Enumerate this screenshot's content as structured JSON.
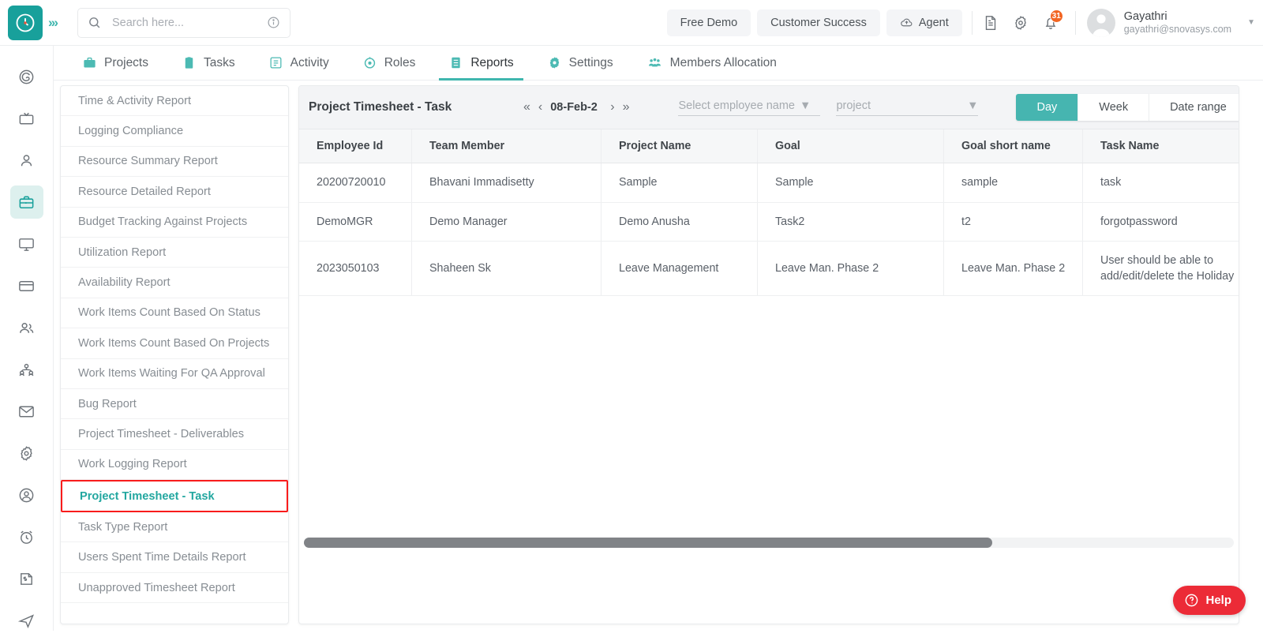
{
  "header": {
    "logo_icon": "clock-logo-icon",
    "expand_icon": "chevron-double-right-icon",
    "search": {
      "placeholder": "Search here...",
      "value": "",
      "icon": "search-icon",
      "info_icon": "info-circle-icon"
    },
    "buttons": [
      {
        "label": "Free Demo",
        "icon": ""
      },
      {
        "label": "Customer Success",
        "icon": ""
      },
      {
        "label": "Agent",
        "icon": "cloud-upload-icon"
      }
    ],
    "icons": [
      {
        "name": "document-icon"
      },
      {
        "name": "gear-icon"
      },
      {
        "name": "bell-icon",
        "badge": "31"
      }
    ],
    "user": {
      "name": "Gayathri",
      "email": "gayathri@snovasys.com",
      "avatar_icon": "avatar-icon",
      "caret_icon": "chevron-down-icon"
    },
    "accent": "#18a09b",
    "badge_color": "#f26522"
  },
  "nav": {
    "tabs": [
      {
        "label": "Projects",
        "icon": "briefcase-icon",
        "active": false
      },
      {
        "label": "Tasks",
        "icon": "clipboard-icon",
        "active": false
      },
      {
        "label": "Activity",
        "icon": "list-icon",
        "active": false
      },
      {
        "label": "Roles",
        "icon": "target-icon",
        "active": false
      },
      {
        "label": "Reports",
        "icon": "report-icon",
        "active": true
      },
      {
        "label": "Settings",
        "icon": "gear-icon",
        "active": false
      },
      {
        "label": "Members Allocation",
        "icon": "people-group-icon",
        "active": false
      }
    ]
  },
  "rail": {
    "items": [
      {
        "icon": "dashboard-spiral-icon",
        "active": false
      },
      {
        "icon": "tv-icon",
        "active": false
      },
      {
        "icon": "user-icon",
        "active": false
      },
      {
        "icon": "briefcase-icon",
        "active": true
      },
      {
        "icon": "monitor-icon",
        "active": false
      },
      {
        "icon": "credit-card-icon",
        "active": false
      },
      {
        "icon": "users-icon",
        "active": false
      },
      {
        "icon": "org-chart-icon",
        "active": false
      },
      {
        "icon": "mail-icon",
        "active": false
      },
      {
        "icon": "gear-icon",
        "active": false
      },
      {
        "icon": "user-circle-icon",
        "active": false
      },
      {
        "icon": "alarm-clock-icon",
        "active": false
      },
      {
        "icon": "invoice-icon",
        "active": false
      },
      {
        "icon": "send-icon",
        "active": false
      }
    ],
    "active_bg": "#ddf0ee",
    "active_fg": "#18a09b"
  },
  "reports_list": {
    "items": [
      {
        "label": "Time & Activity Report",
        "selected": false
      },
      {
        "label": "Logging Compliance",
        "selected": false
      },
      {
        "label": "Resource Summary Report",
        "selected": false
      },
      {
        "label": "Resource Detailed Report",
        "selected": false
      },
      {
        "label": "Budget Tracking Against Projects",
        "selected": false
      },
      {
        "label": "Utilization Report",
        "selected": false
      },
      {
        "label": "Availability Report",
        "selected": false
      },
      {
        "label": "Work Items Count Based On Status",
        "selected": false
      },
      {
        "label": "Work Items Count Based On Projects",
        "selected": false
      },
      {
        "label": "Work Items Waiting For QA Approval",
        "selected": false
      },
      {
        "label": "Bug Report",
        "selected": false
      },
      {
        "label": "Project Timesheet - Deliverables",
        "selected": false
      },
      {
        "label": "Work Logging Report",
        "selected": false
      },
      {
        "label": "Project Timesheet - Task",
        "selected": true
      },
      {
        "label": "Task Type Report",
        "selected": false
      },
      {
        "label": "Users Spent Time Details Report",
        "selected": false
      },
      {
        "label": "Unapproved Timesheet Report",
        "selected": false
      }
    ],
    "selected_color": "#23a7a0",
    "highlight_border": "#f91c1c"
  },
  "toolbar": {
    "title": "Project Timesheet - Task",
    "date_first_icon": "double-chevron-left-icon",
    "date_prev_icon": "chevron-left-icon",
    "date_value": "08-Feb-2",
    "date_next_icon": "chevron-right-icon",
    "date_last_icon": "double-chevron-right-icon",
    "employee_select": {
      "placeholder": "Select employee name",
      "value": "",
      "caret_icon": "caret-down-icon"
    },
    "project_select": {
      "placeholder": "project",
      "value": "",
      "caret_icon": "caret-down-icon"
    },
    "range_buttons": [
      {
        "label": "Day",
        "active": true
      },
      {
        "label": "Week",
        "active": false
      },
      {
        "label": "Date range",
        "active": false
      }
    ],
    "refresh_icon": "refresh-icon",
    "download_icon": "download-icon",
    "active_color": "#46b5b0"
  },
  "table": {
    "columns": [
      "Employee Id",
      "Team Member",
      "Project Name",
      "Goal",
      "Goal short name",
      "Task Name"
    ],
    "rows": [
      [
        "20200720010",
        "Bhavani Immadisetty",
        "Sample",
        "Sample",
        "sample",
        "task"
      ],
      [
        "DemoMGR",
        "Demo Manager",
        "Demo Anusha",
        "Task2",
        "t2",
        "forgotpassword"
      ],
      [
        "2023050103",
        "Shaheen Sk",
        "Leave Management",
        "Leave Man. Phase 2",
        "Leave Man. Phase 2",
        "User should be able to add/edit/delete the Holiday"
      ]
    ]
  },
  "scrollbar": {
    "thumb_percent": "74%"
  },
  "help": {
    "label": "Help",
    "icon": "question-circle-icon",
    "color": "#ec2b37"
  }
}
